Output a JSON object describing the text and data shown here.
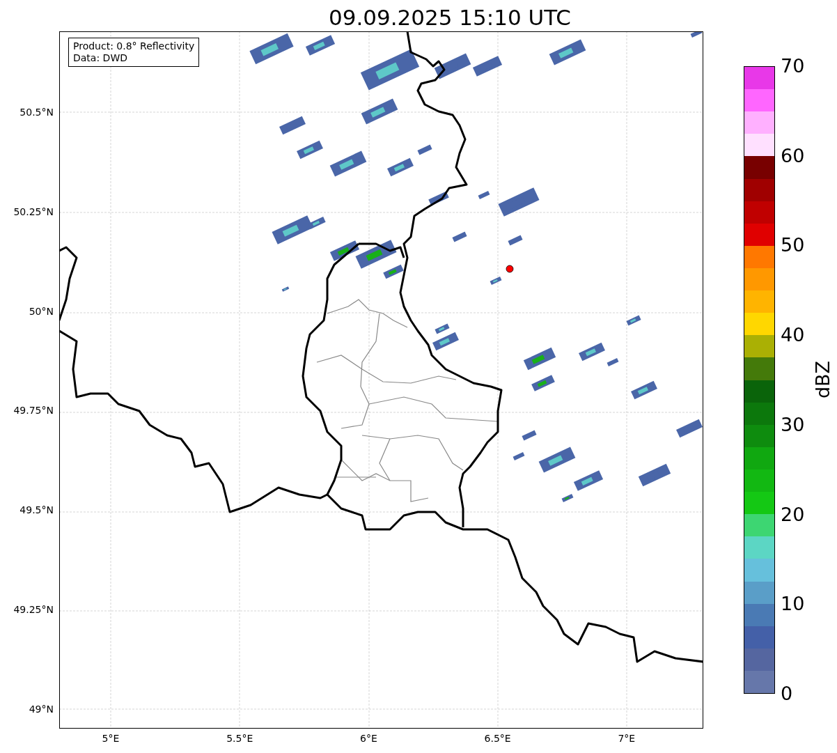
{
  "title": "09.09.2025 15:10 UTC",
  "info_box": [
    "Product: 0.8° Reflectivity",
    "Data: DWD"
  ],
  "map": {
    "kind": "map",
    "y_ticks": [
      "50.5°N",
      "50.25°N",
      "50°N",
      "49.75°N",
      "49.5°N",
      "49.25°N",
      "49°N"
    ],
    "x_ticks": [
      "5°E",
      "5.5°E",
      "6°E",
      "6.5°E",
      "7°E"
    ]
  },
  "colorbar": {
    "label": "dBZ",
    "ticks": [
      "70",
      "60",
      "50",
      "40",
      "30",
      "20",
      "10",
      "0"
    ],
    "segments": [
      {
        "color": "#e838e8"
      },
      {
        "color": "#ff66ff"
      },
      {
        "color": "#ffb0ff"
      },
      {
        "color": "#ffe0ff"
      },
      {
        "color": "#780000"
      },
      {
        "color": "#a00000"
      },
      {
        "color": "#c00000"
      },
      {
        "color": "#e00000"
      },
      {
        "color": "#ff7800"
      },
      {
        "color": "#ff9800"
      },
      {
        "color": "#ffb400"
      },
      {
        "color": "#ffd700"
      },
      {
        "color": "#aab004"
      },
      {
        "color": "#447a0a"
      },
      {
        "color": "#0a640a"
      },
      {
        "color": "#0c780c"
      },
      {
        "color": "#0e8c0e"
      },
      {
        "color": "#10a810"
      },
      {
        "color": "#12b812"
      },
      {
        "color": "#14c814"
      },
      {
        "color": "#3dd672"
      },
      {
        "color": "#5cd6c4"
      },
      {
        "color": "#66c0dc"
      },
      {
        "color": "#5a9ec8"
      },
      {
        "color": "#4a7ab4"
      },
      {
        "color": "#4460a8"
      },
      {
        "color": "#5566a0"
      },
      {
        "color": "#6677aa"
      }
    ]
  }
}
